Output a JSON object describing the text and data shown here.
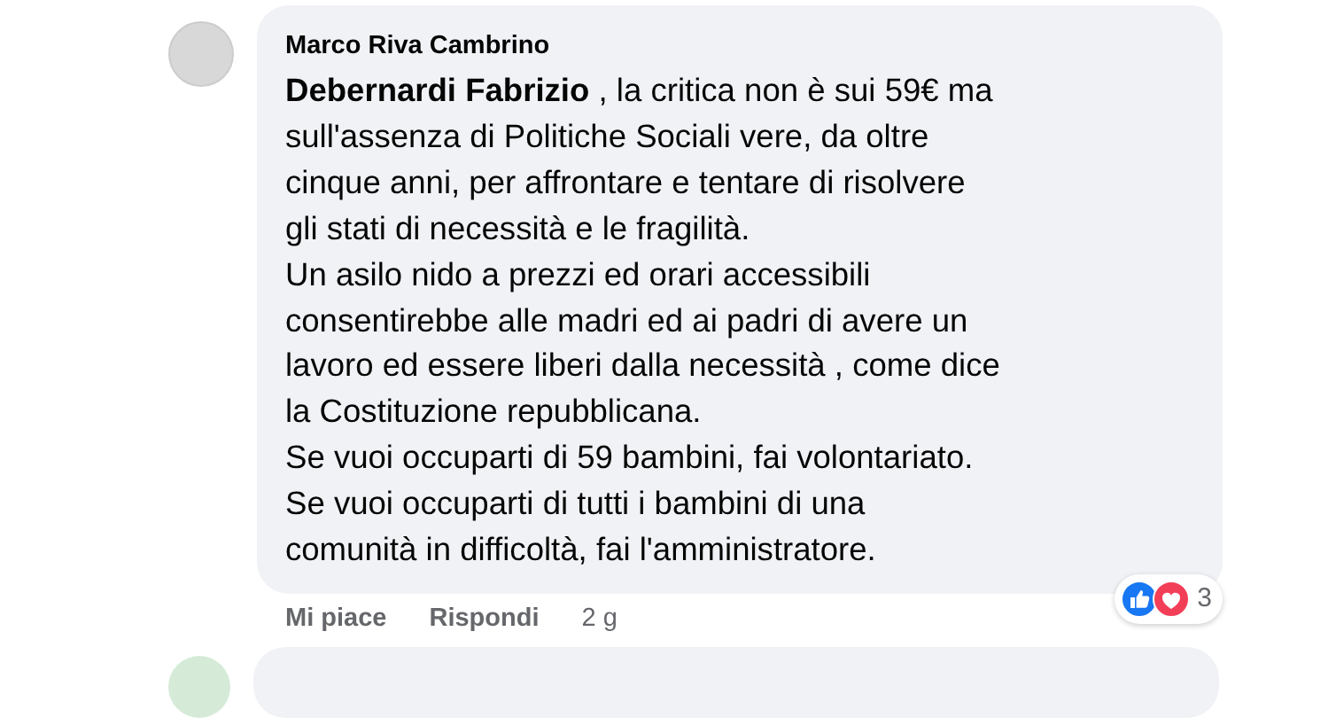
{
  "comment": {
    "author": "Marco Riva Cambrino",
    "text_lines": [
      "**Debernardi Fabrizio** , la critica non è sui 59€ ma",
      "sull'assenza di Politiche Sociali vere, da oltre",
      "cinque anni, per affrontare e tentare di risolvere",
      "gli stati di necessità e le fragilità.",
      "Un asilo nido a prezzi ed orari accessibili",
      "consentirebbe alle madri ed ai padri di avere un",
      "lavoro ed essere liberi dalla necessità , come dice",
      "la Costituzione repubblicana.",
      "Se vuoi occuparti di 59 bambini, fai volontariato.",
      "Se vuoi occuparti di tutti i bambini di una",
      "comunità in difficoltà, fai l'amministratore."
    ],
    "reaction_count": "3",
    "actions": [
      "Mi piace",
      "Rispondi"
    ],
    "time": "2 g"
  }
}
